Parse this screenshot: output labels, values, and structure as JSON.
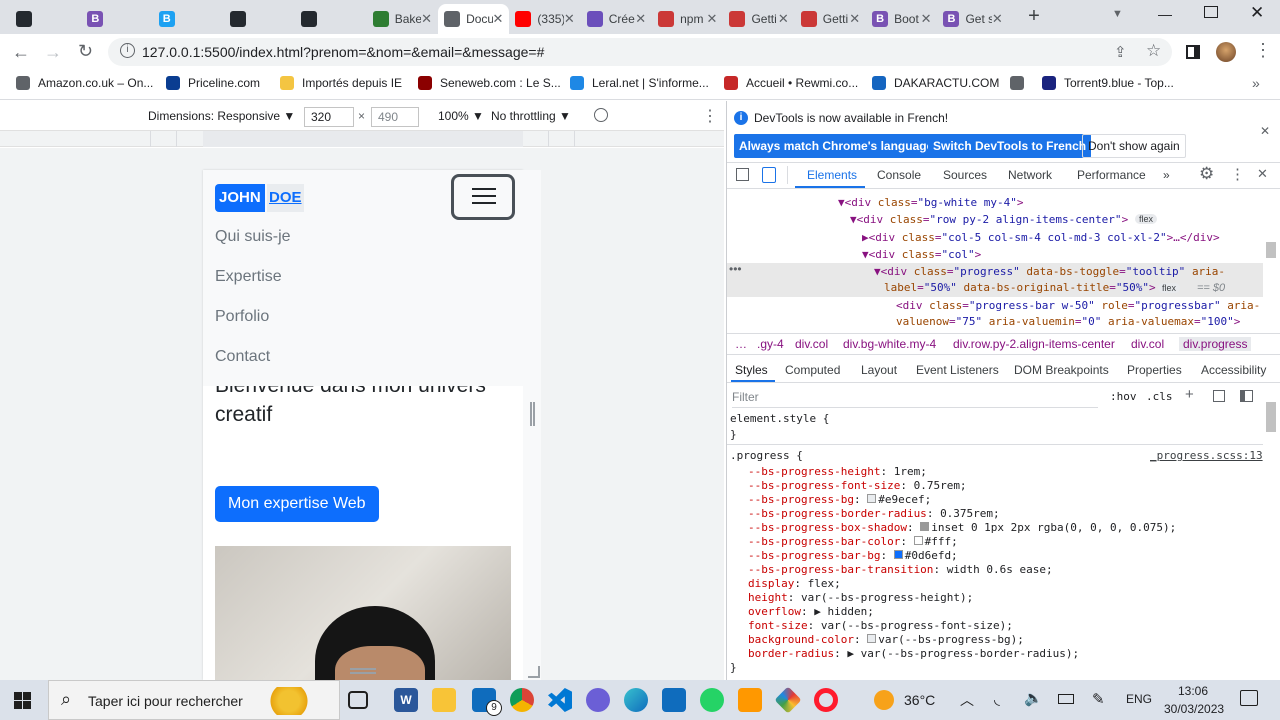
{
  "browser": {
    "tabs": [
      {
        "title": "",
        "color": "#24292f",
        "icon": "github-icon"
      },
      {
        "title": "",
        "color": "#7952b3",
        "icon": "bootstrap-icon",
        "glyph": "B"
      },
      {
        "title": "",
        "color": "#1da1f2",
        "icon": "bootstrap-icon",
        "glyph": "B"
      },
      {
        "title": "",
        "color": "#24292f",
        "icon": "github-icon"
      },
      {
        "title": "",
        "color": "#24292f",
        "icon": "github-icon"
      },
      {
        "title": "Bake",
        "color": "#2e7d32",
        "icon": "bake-icon"
      },
      {
        "title": "Docu",
        "color": "#5f6368",
        "icon": "globe-icon",
        "active": true
      },
      {
        "title": "(335)",
        "color": "#ff0000",
        "icon": "youtube-icon"
      },
      {
        "title": "Crée",
        "color": "#6b4fbb",
        "icon": "canva-icon"
      },
      {
        "title": "npm",
        "color": "#cb3837",
        "icon": "npm-icon"
      },
      {
        "title": "Getti",
        "color": "#cb3837",
        "icon": "npm-icon"
      },
      {
        "title": "Getti",
        "color": "#cb3837",
        "icon": "npm-icon"
      },
      {
        "title": "Boot",
        "color": "#7952b3",
        "icon": "bootstrap-icon",
        "glyph": "B"
      },
      {
        "title": "Get s",
        "color": "#7952b3",
        "icon": "bootstrap-icon",
        "glyph": "B"
      }
    ],
    "url": "127.0.0.1:5500/index.html?prenom=&nom=&email=&message=#",
    "bookmarks": [
      {
        "label": "Amazon.co.uk – On...",
        "color": "#5f6368"
      },
      {
        "label": "Priceline.com",
        "color": "#0a3d91"
      },
      {
        "label": "Importés depuis IE",
        "color": "#f4c542"
      },
      {
        "label": "Seneweb.com : Le S...",
        "color": "#8b0000"
      },
      {
        "label": "Leral.net | S'informe...",
        "color": "#1e88e5"
      },
      {
        "label": "Accueil • Rewmi.co...",
        "color": "#c62828"
      },
      {
        "label": "DAKARACTU.COM",
        "color": "#1565c0"
      },
      {
        "label": "",
        "color": "#5f6368"
      },
      {
        "label": "Torrent9.blue - Top...",
        "color": "#1a237e"
      }
    ]
  },
  "device_toolbar": {
    "dimensions_label": "Dimensions: Responsive ▼",
    "width": "320",
    "height": "490",
    "times": "×",
    "zoom": "100% ▼",
    "throttle": "No throttling ▼"
  },
  "page": {
    "brand_part1": "JOHN",
    "brand_part2": "DOE",
    "nav_links": [
      "Qui suis-je",
      "Expertise",
      "Porfolio",
      "Contact"
    ],
    "hero_line1": "Bienvenue dans mon univers",
    "hero_line2": "creatif",
    "hero_button": "Mon expertise Web"
  },
  "devtools": {
    "banner": "DevTools is now available in French!",
    "btn_match": "Always match Chrome's language",
    "btn_switch": "Switch DevTools to French",
    "btn_dont": "Don't show again",
    "tabs": [
      "Elements",
      "Console",
      "Sources",
      "Network",
      "Performance",
      "»"
    ],
    "dom_lines": [
      "▼<div class=\"bg-white my-4\">",
      "▼<div class=\"row py-2 align-items-center\">",
      "▶<div class=\"col-5 col-sm-4 col-md-3 col-xl-2\">…</div>",
      "▼<div class=\"col\">",
      "▼<div class=\"progress\" data-bs-toggle=\"tooltip\" aria-",
      "label=\"50%\" data-bs-original-title=\"50%\">",
      "<div class=\"progress-bar w-50\" role=\"progressbar\" aria-",
      "valuenow=\"75\" aria-valuemin=\"0\" aria-valuemax=\"100\">"
    ],
    "flex_badge": "flex",
    "sel_suffix": "== $0",
    "breadcrumbs": [
      "…",
      ".gy-4",
      "div.col",
      "div.bg-white.my-4",
      "div.row.py-2.align-items-center",
      "div.col",
      "div.progress"
    ],
    "subtabs": [
      "Styles",
      "Computed",
      "Layout",
      "Event Listeners",
      "DOM Breakpoints",
      "Properties",
      "Accessibility"
    ],
    "filter_placeholder": "Filter",
    "hov": ":hov",
    "cls": ".cls",
    "element_style": "element.style {",
    "close_brace": "}",
    "selector": ".progress {",
    "source": "_progress.scss:13",
    "rules": [
      {
        "p": "--bs-progress-height",
        "v": "1rem;"
      },
      {
        "p": "--bs-progress-font-size",
        "v": "0.75rem;"
      },
      {
        "p": "--bs-progress-bg",
        "v": "#e9ecef;",
        "swatch": "#e9ecef"
      },
      {
        "p": "--bs-progress-border-radius",
        "v": "0.375rem;"
      },
      {
        "p": "--bs-progress-box-shadow",
        "v": "inset 0 1px 2px rgba(0, 0, 0, 0.075);",
        "swatch": "#999"
      },
      {
        "p": "--bs-progress-bar-color",
        "v": "#fff;",
        "swatch": "#fff"
      },
      {
        "p": "--bs-progress-bar-bg",
        "v": "#0d6efd;",
        "swatch": "#0d6efd"
      },
      {
        "p": "--bs-progress-bar-transition",
        "v": "width 0.6s ease;"
      },
      {
        "p": "display",
        "v": "flex;"
      },
      {
        "p": "height",
        "v": "var(--bs-progress-height);"
      },
      {
        "p": "overflow",
        "v": "▶ hidden;"
      },
      {
        "p": "font-size",
        "v": "var(--bs-progress-font-size);"
      },
      {
        "p": "background-color",
        "v": "var(--bs-progress-bg);",
        "swatch": "#e9ecef"
      },
      {
        "p": "border-radius",
        "v": "▶ var(--bs-progress-border-radius);"
      }
    ]
  },
  "taskbar": {
    "search": "Taper ici pour rechercher",
    "weather": "36°C",
    "lang": "ENG",
    "time": "13:06",
    "date": "30/03/2023",
    "mail_badge": "9"
  },
  "colors": {
    "accent": "#0d6efd",
    "chrome_blue": "#1a73e8"
  }
}
